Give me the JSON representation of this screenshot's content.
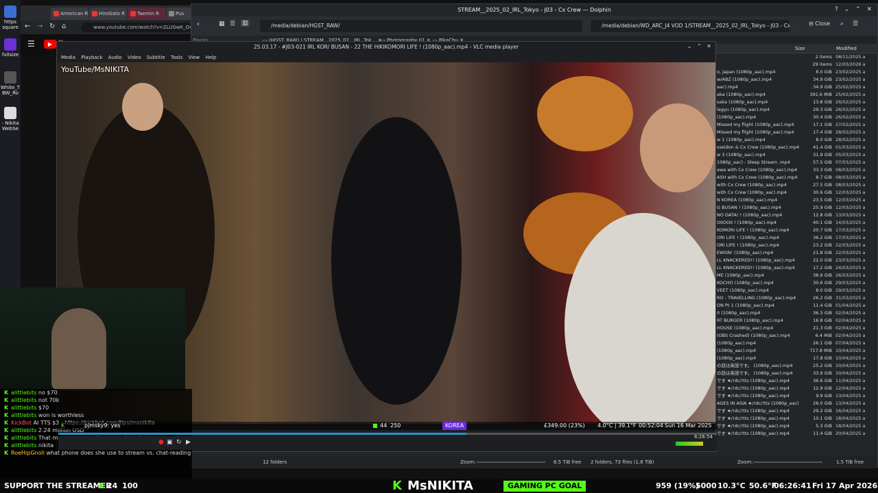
{
  "desktop": {
    "items": [
      {
        "label": "https square"
      },
      {
        "label": "fullsize"
      },
      {
        "label": "White_T BW_Ro"
      },
      {
        "label": "- Nikita WebSe"
      }
    ]
  },
  "browser": {
    "tabs": [
      "American R",
      "HiroGato R",
      "Taemin R",
      "Pus"
    ],
    "url": "www.youtube.com/watch?v=ZLUGwK_OnIs",
    "yt_logo": "Y"
  },
  "dolphin": {
    "title": "STREAM__2025_02_IRL_Tokyo - J03 - Cx Crew — Dolphin",
    "left_path": "/media/debian/HGST_RAW/",
    "right_path": "/media/debian/WD_ARC_J4 VOD 1/STREAM__2025_02_IRL_Tokyo - J03 - Cx Crew/",
    "close_label": "Close",
    "places_label": "Places",
    "tabs": [
      "(HGST_RAW) | STREAM__2025_02__IRL_Tok...",
      "Photography 01",
      "PikaChu"
    ],
    "col_size": "Size",
    "col_modified": "Modified",
    "files": [
      {
        "name": "",
        "size": "2 items",
        "date": "08/11/2025 a"
      },
      {
        "name": "",
        "size": "29 items",
        "date": "12/03/2026 a"
      },
      {
        "name": "o, Japan (1080p_aac).mp4",
        "size": "8.0 GiB",
        "date": "23/02/2025 a"
      },
      {
        "name": "w/ABZ (1080p_aac).mp4",
        "size": "34.9 GiB",
        "date": "23/02/2025 a"
      },
      {
        "name": "aac).mp4",
        "size": "34.9 GiB",
        "date": "25/02/2025 a"
      },
      {
        "name": "aka (1080p_aac).mp4",
        "size": "391.6 MiB",
        "date": "25/02/2025 a"
      },
      {
        "name": "saka (1080p_aac).mp4",
        "size": "13.8 GiB",
        "date": "26/02/2025 a"
      },
      {
        "name": "lagyu (1080p_aac).mp4",
        "size": "29.3 GiB",
        "date": "26/02/2025 a"
      },
      {
        "name": "(1080p_aac).mp4",
        "size": "30.4 GiB",
        "date": "26/02/2025 a"
      },
      {
        "name": "Missed my flight (1080p_aac).mp4",
        "size": "17.1 GiB",
        "date": "27/02/2025 a"
      },
      {
        "name": "Missed my flight (1080p_aac).mp4",
        "size": "17.4 GiB",
        "date": "28/02/2025 a"
      },
      {
        "name": "w 1 (1080p_aac).mp4",
        "size": "8.0 GiB",
        "date": "28/02/2025 a"
      },
      {
        "name": "sseidon & Cx Crew (1080p_aac).mp4",
        "size": "41.4 GiB",
        "date": "01/03/2025 a"
      },
      {
        "name": "w 3 (1080p_aac).mp4",
        "size": "31.9 GiB",
        "date": "05/03/2025 a"
      },
      {
        "name": "1080p_aac) - Sleep Stream .mp4",
        "size": "57.5 GiB",
        "date": "07/03/2025 a"
      },
      {
        "name": "awa with Cx Crew (1080p_aac).mp4",
        "size": "33.3 GiB",
        "date": "08/03/2025 a"
      },
      {
        "name": "ASH with Cx Crew (1080p_aac).mp4",
        "size": "8.7 GiB",
        "date": "08/03/2025 a"
      },
      {
        "name": "with Cx Crew (1080p_aac).mp4",
        "size": "27.5 GiB",
        "date": "08/03/2025 a"
      },
      {
        "name": "with Cx Crew (1080p_aac).mp4",
        "size": "30.6 GiB",
        "date": "12/03/2025 a"
      },
      {
        "name": "N KOREA (1080p_aac).mp4",
        "size": "23.5 GiB",
        "date": "12/03/2025 a"
      },
      {
        "name": "G BUSAN ! (1080p_aac).mp4",
        "size": "25.9 GiB",
        "date": "12/03/2025 a"
      },
      {
        "name": "NO DATA! ! (1080p_aac).mp4",
        "size": "12.8 GiB",
        "date": "13/03/2025 a"
      },
      {
        "name": "OIIOOII ! (1080p_aac).mp4",
        "size": "40.1 GiB",
        "date": "14/03/2025 a"
      },
      {
        "name": "KOMORI LIFE ! (1080p_aac).mp4",
        "size": "20.7 GiB",
        "date": "17/03/2025 a"
      },
      {
        "name": "ORI LIFE ! (1080p_aac).mp4",
        "size": "36.2 GiB",
        "date": "17/03/2025 a"
      },
      {
        "name": "ORI LIFE ! (1080p_aac).mp4",
        "size": "23.2 GiB",
        "date": "22/03/2025 a"
      },
      {
        "name": "EWON! (1080p_aac).mp4",
        "size": "21.8 GiB",
        "date": "22/03/2025 a"
      },
      {
        "name": "LL KNACKERED!! (1080p_aac).mp4",
        "size": "22.0 GiB",
        "date": "23/03/2025 a"
      },
      {
        "name": "LL KNACKERED!! (1080p_aac).mp4",
        "size": "17.2 GiB",
        "date": "24/03/2025 a"
      },
      {
        "name": "ME (1080p_aac).mp4",
        "size": "38.9 GiB",
        "date": "26/03/2025 a"
      },
      {
        "name": "KOCHO (1080p_aac).mp4",
        "size": "30.6 GiB",
        "date": "29/03/2025 a"
      },
      {
        "name": "VEET (1080p_aac).mp4",
        "size": "8.0 GiB",
        "date": "29/03/2025 a"
      },
      {
        "name": "RO - TRAVELLING (1080p_aac).mp4",
        "size": "26.2 GiB",
        "date": "31/03/2025 a"
      },
      {
        "name": "ON Pt 1 (1080p_aac).mp4",
        "size": "11.4 GiB",
        "date": "01/04/2025 a"
      },
      {
        "name": "0 (1080p_aac).mp4",
        "size": "36.3 GiB",
        "date": "02/04/2025 a"
      },
      {
        "name": "RT BURGER (1080p_aac).mp4",
        "size": "16.8 GiB",
        "date": "02/04/2025 a"
      },
      {
        "name": "HOUSE (1080p_aac).mp4",
        "size": "21.3 GiB",
        "date": "02/04/2025 a"
      },
      {
        "name": "(OBS Crashed) (1080p_aac).mp4",
        "size": "6.4 MiB",
        "date": "02/04/2025 a"
      },
      {
        "name": "(1080p_aac).mp4",
        "size": "26.1 GiB",
        "date": "07/04/2025 a"
      },
      {
        "name": "(1080p_aac).mp4",
        "size": "717.8 MiB",
        "date": "10/04/2025 a"
      },
      {
        "name": "(1080p_aac).mp4",
        "size": "17.8 GiB",
        "date": "10/04/2025 a"
      },
      {
        "name": "の話は英語です。 (1080p_aac).mp4",
        "size": "25.2 GiB",
        "date": "10/04/2025 a"
      },
      {
        "name": "の話は英語です。 (1080p_aac).mp4",
        "size": "33.9 GiB",
        "date": "10/04/2025 a"
      },
      {
        "name": "です ★/!dc/!tts (1080p_aac).mp4",
        "size": "36.6 GiB",
        "date": "11/04/2025 a"
      },
      {
        "name": "です ★/!dc/!tts (1080p_aac).mp4",
        "size": "12.9 GiB",
        "date": "12/04/2025 a"
      },
      {
        "name": "です ★/!dc/!tts (1080p_aac).mp4",
        "size": "9.9 GiB",
        "date": "13/04/2025 a"
      },
      {
        "name": "AGES IN ASIA ★/!dc/!tts (1080p_aac).mp4",
        "size": "26.0 GiB",
        "date": "13/04/2025 a"
      },
      {
        "name": "です ★/!dc/!tts (1080p_aac).mp4",
        "size": "29.2 GiB",
        "date": "16/04/2025 a"
      },
      {
        "name": "です ★/!dc/!tts (1080p_aac).mp4",
        "size": "10.1 GiB",
        "date": "18/04/2025 a"
      },
      {
        "name": "です ★/!dc/!tts (1080p_aac).mp4",
        "size": "5.3 GiB",
        "date": "18/04/2025 a"
      },
      {
        "name": "です ★/!dc/!tts (1080p_aac).mp4",
        "size": "11.4 GiB",
        "date": "20/04/2025 a"
      }
    ],
    "status_left": "12 folders",
    "zoom_label": "Zoom:",
    "free_left": "6.5 TiB free",
    "status_mid": "2 folders, 73 files (1.8 TiB)",
    "zoom_label_right": "Zoom:",
    "free_right": "1.5 TiB free"
  },
  "vlc": {
    "title": "25.03.17 - #J03-021 IRL KOR/ BUSAN - 22 THE HIKIKOMORI LIFE ! (1080p_aac).mp4 - VLC media player",
    "menu": [
      "Media",
      "Playback",
      "Audio",
      "Video",
      "Subtitle",
      "Tools",
      "View",
      "Help"
    ],
    "watermark": "YouTube/MsNIKITA",
    "progress": 0.62,
    "time_right": "6:26:54"
  },
  "stream": {
    "ticker": {
      "chat_user": "pjmsky9",
      "chat_text": ": yes",
      "viewers": "44",
      "followers": "250",
      "country": "KOREA",
      "money": "£349.00 (23%)",
      "temp": "4.0°C | 39.1°F",
      "clock": "00:52:04",
      "date": "Sun 16 Mar 2025"
    },
    "chat": [
      {
        "user": "alittlebits",
        "text": "no $70",
        "color": "green"
      },
      {
        "user": "alittlebits",
        "text": "not 70k",
        "color": "green"
      },
      {
        "user": "alittlebits",
        "text": "$70",
        "color": "green"
      },
      {
        "user": "alittlebits",
        "text": "won is worthless",
        "color": "green"
      },
      {
        "user": "KickBot",
        "text": "AI TTS $3 : https://kickbot.com/tips/msnikita",
        "color": "red"
      },
      {
        "user": "alittlebits",
        "text": "2.24 million USD",
        "color": "green"
      },
      {
        "user": "alittlebits",
        "text": "That means you need to marry taemin",
        "color": "green"
      },
      {
        "user": "alittlebits",
        "text": "nikita",
        "color": "green"
      },
      {
        "user": "RoeHipGnoll",
        "text": "what phone does she use to stream vs. chat-reading phone",
        "color": "gold"
      }
    ],
    "bottom": {
      "support": "SUPPORT THE STREAMER",
      "count_a": "24",
      "count_b": "100",
      "brand": "MsNIKITA",
      "goal": "GAMING PC GOAL",
      "goal_val": "959 (19%)",
      "goal_target": "5000",
      "temp": "10.3°C",
      "temp_f": "50.6°F",
      "clock": "06:26:41",
      "date": "Fri 17 Apr 2026"
    }
  },
  "colors": {
    "kick_green": "#53fc18",
    "vlc_progress": "#29c"
  }
}
